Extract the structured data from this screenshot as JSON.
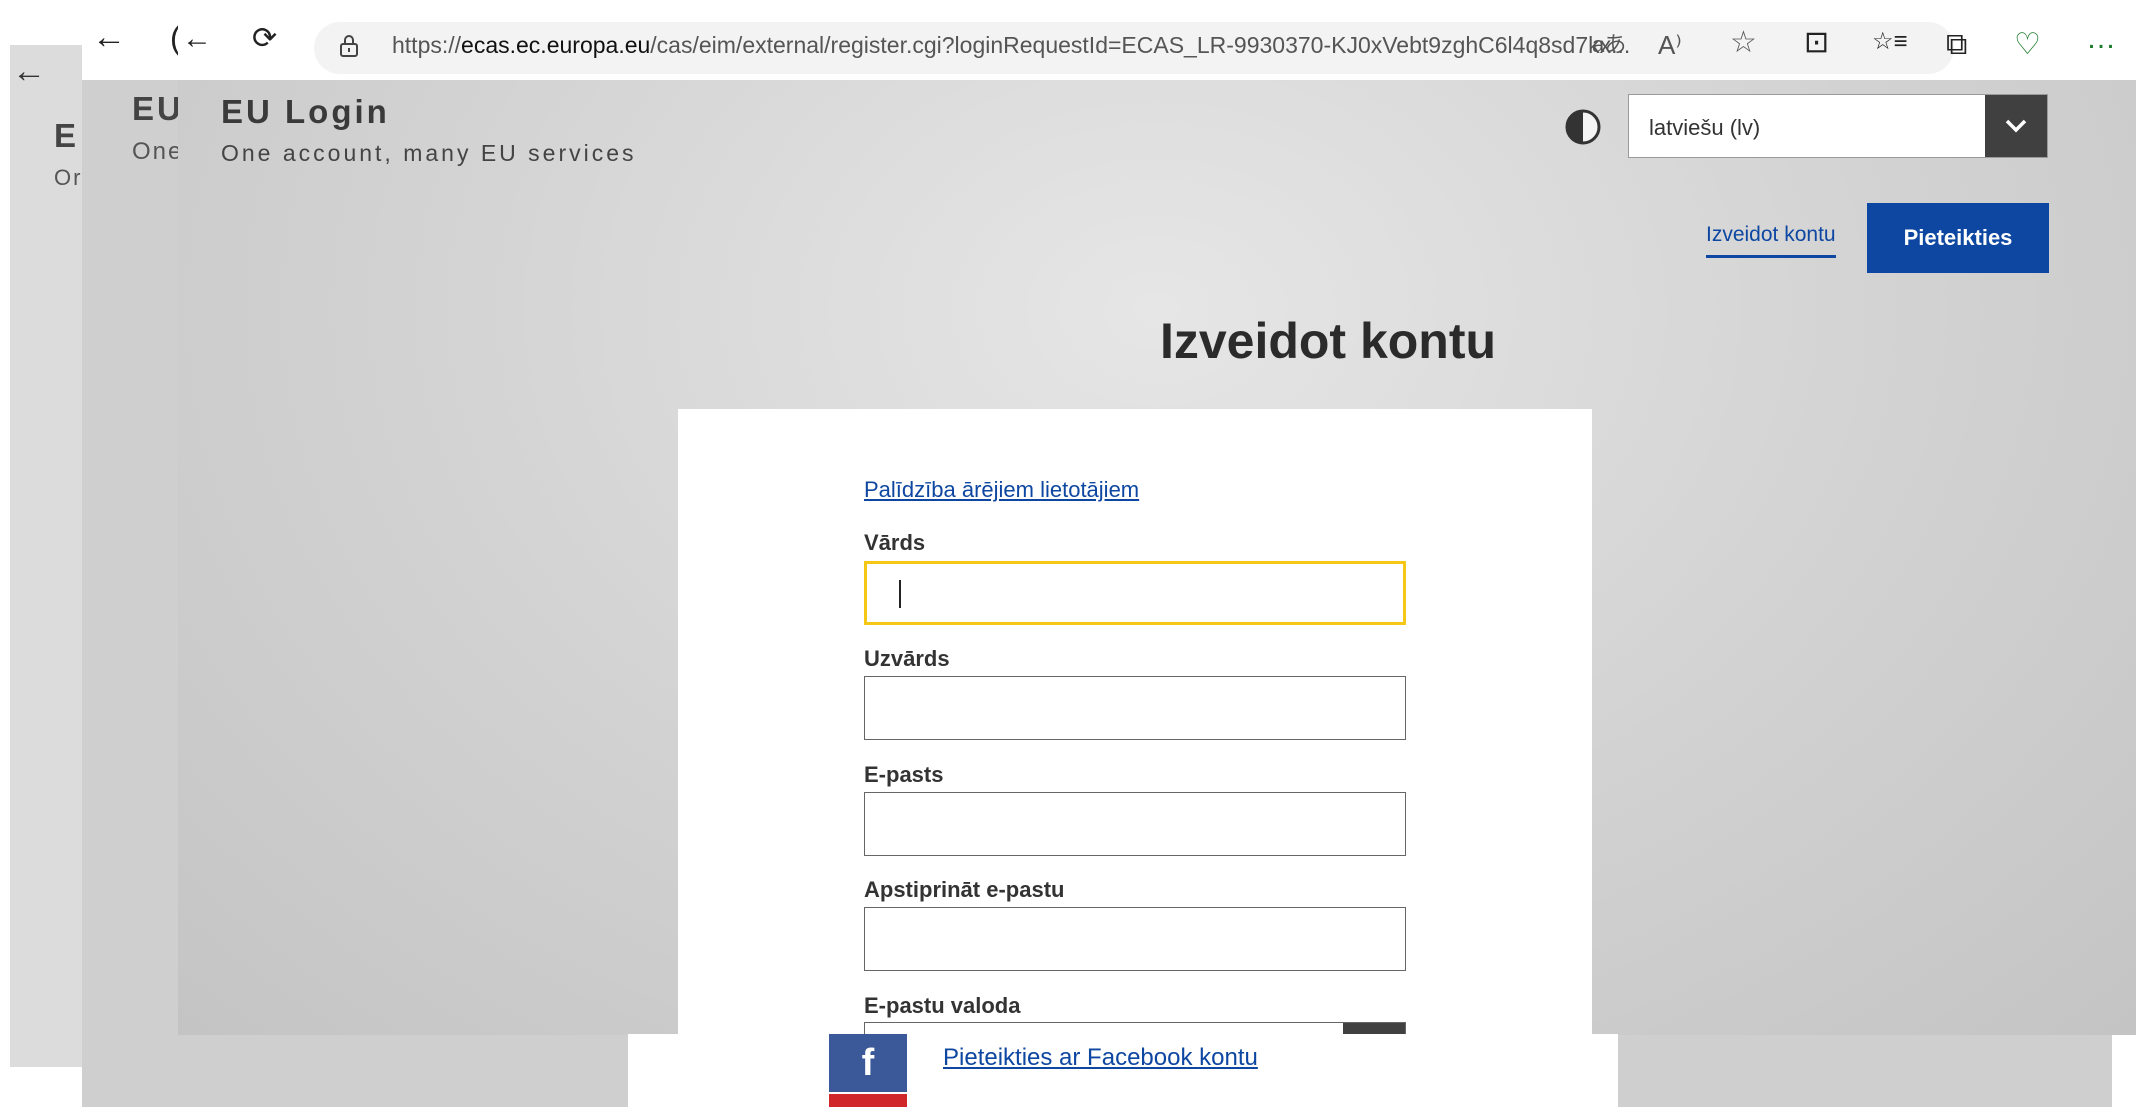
{
  "browser": {
    "url_prefix": "https://",
    "url_host": "ecas.ec.europa.eu",
    "url_path": "/cas/eim/external/register.cgi?loginRequestId=ECAS_LR-9930370-KJ0xVebt9zghC6l4q8sd7kx...",
    "toolbar_icons": [
      "back-arrow-icon",
      "reload-icon",
      "lock-icon",
      "translate-icon",
      "read-aloud-icon",
      "favorite-star-icon",
      "split-screen-icon",
      "favorites-list-icon",
      "collections-icon",
      "browser-essentials-icon",
      "more-icon"
    ],
    "glyphs": {
      "back": "←",
      "reload": "⟳",
      "translate": "aあ",
      "read_aloud": "A⁾",
      "star": "☆",
      "split": "⊡",
      "favorites": "☆≡",
      "collections": "⧉",
      "essentials": "♡",
      "more": "…"
    }
  },
  "background_windows": {
    "back_arrow": "←",
    "mid_back": "←",
    "mid_reload": "(",
    "brand_short_back": "E",
    "sub_short_back": "Or",
    "brand_short_mid": "EU",
    "sub_short_mid": "One"
  },
  "header": {
    "brand_title": "EU Login",
    "brand_subtitle": "One account, many EU services",
    "language_selected": "latviešu (lv)"
  },
  "nav": {
    "register_label": "Izveidot kontu",
    "login_label": "Pieteikties"
  },
  "page": {
    "title": "Izveidot kontu"
  },
  "form": {
    "help_link": "Palīdzība ārējiem lietotājiem",
    "fields": [
      {
        "label": "Vārds",
        "value": ""
      },
      {
        "label": "Uzvārds",
        "value": ""
      },
      {
        "label": "E-pasts",
        "value": ""
      },
      {
        "label": "Apstiprināt e-pastu",
        "value": ""
      },
      {
        "label": "E-pastu valoda",
        "value": ""
      }
    ]
  },
  "social": {
    "facebook_glyph": "f",
    "facebook_link": "Pieteikties ar Facebook kontu"
  },
  "colors": {
    "accent_blue": "#0e47a1",
    "focus_yellow": "#f5c817",
    "facebook_blue": "#3b5998",
    "red": "#d0282a"
  }
}
